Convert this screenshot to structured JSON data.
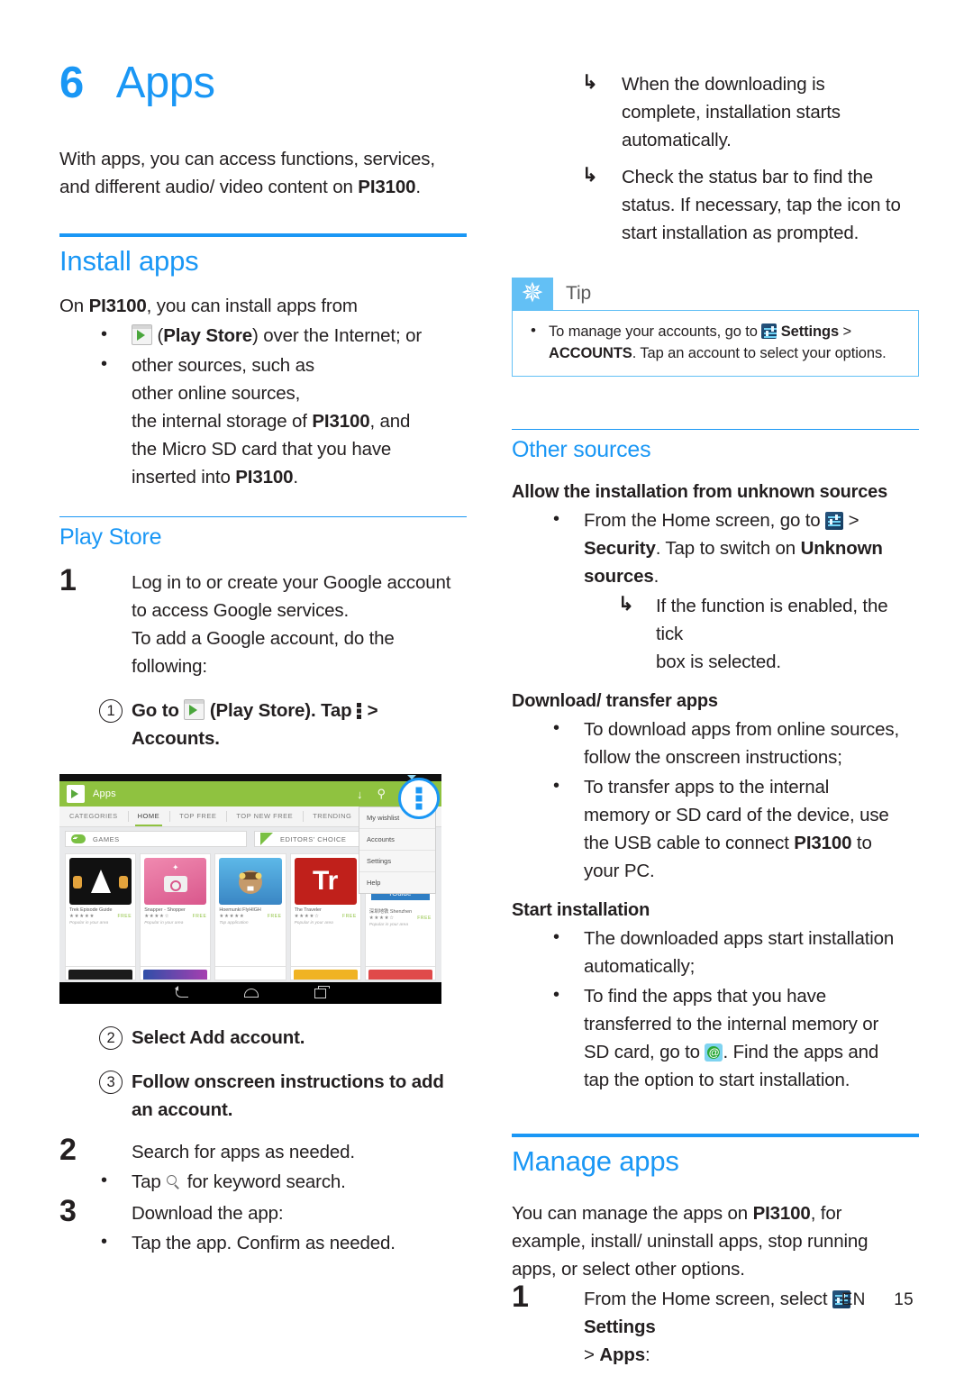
{
  "meta": {
    "accent_blue": "#1a97f5",
    "text_color": "#231f20",
    "tip_blue": "#63c0f5",
    "play_green": "#8fc240"
  },
  "chapter": {
    "number": "6",
    "title": "Apps"
  },
  "intro": {
    "line1_a": "With apps, you can access functions, services,",
    "line1_b": "and different audio/ video content on ",
    "device": "PI3100",
    "line1_c": "."
  },
  "install_apps": {
    "heading": "Install apps",
    "lead_a": "On ",
    "lead_device": "PI3100",
    "lead_b": ", you can install apps from",
    "bullets": [
      {
        "icon": "play-store-icon",
        "bold": "Play Store",
        "pre": "(",
        "post": ") over the Internet; or"
      },
      {
        "lines": [
          "other sources, such as",
          "other online sources,",
          "the internal storage of PI3100, and",
          "the Micro SD card that you have",
          "inserted into PI3100."
        ]
      }
    ]
  },
  "play_store": {
    "heading": "Play Store",
    "step1": {
      "number": "1",
      "line1": "Log in to or create your Google account",
      "line2": "to access Google services.",
      "line3": "To add a Google account, do the following:"
    },
    "substeps": [
      {
        "number": "1",
        "pre": "Go to ",
        "icon": "play-store-icon",
        "mid": " (Play Store). Tap ",
        "icon2": "overflow-menu-icon",
        "post": " >",
        "line2": "Accounts."
      },
      {
        "number": "2",
        "text": "Select Add account."
      },
      {
        "number": "3",
        "text": "Follow onscreen instructions to add",
        "line2": "an account."
      }
    ],
    "step2": {
      "number": "2",
      "text": "Search for apps as needed.",
      "bullet_pre": "Tap ",
      "bullet_icon": "search-icon",
      "bullet_post": " for keyword search."
    },
    "step3": {
      "number": "3",
      "text": "Download the app:",
      "bullet": "Tap the app. Confirm as needed."
    },
    "arrows": [
      {
        "line1": "When the downloading is",
        "line2": "complete, installation starts",
        "line3": "automatically."
      },
      {
        "line1": "Check the status bar to find the",
        "line2": "status. If necessary, tap the icon to",
        "line3": "start installation as prompted."
      }
    ]
  },
  "screenshot": {
    "app_title": "Apps",
    "action_icons": [
      "download-icon",
      "search-icon",
      "overflow-menu-icon"
    ],
    "tabs": [
      "CATEGORIES",
      "HOME",
      "TOP FREE",
      "TOP NEW FREE",
      "TRENDING"
    ],
    "active_tab": "HOME",
    "cards": [
      {
        "label": "GAMES",
        "icon": "gamepad-icon"
      },
      {
        "label": "EDITORS' CHOICE",
        "icon": "editors-choice-icon"
      }
    ],
    "menu_items": [
      "My wishlist",
      "Accounts",
      "Settings",
      "Help"
    ],
    "tiles": [
      {
        "name": "Trek Episode Guide",
        "stars": "★★★★★",
        "price": "FREE",
        "sub": "Popular in your area"
      },
      {
        "name": "Snapper - Shopper",
        "stars": "★★★★☆",
        "price": "FREE",
        "sub": "Popular in your area"
      },
      {
        "name": "Hoemunki FlyHIGH",
        "stars": "★★★★★",
        "price": "FREE",
        "sub": "Top application"
      },
      {
        "name": "The Traveler",
        "stars": "★★★★☆",
        "price": "FREE",
        "sub": "Popular in your area"
      },
      {
        "name": "深圳地铁 Shenzhen",
        "stars": "★★★★☆",
        "price": "FREE",
        "sub": "Popular in your area"
      }
    ],
    "navbar": [
      "back-icon",
      "home-icon",
      "recents-icon"
    ]
  },
  "tip": {
    "label": "Tip",
    "icon": "asterisk-icon",
    "item_a": "To manage your accounts, go to ",
    "item_icon": "settings-icon",
    "item_b_bold": "Settings",
    "item_c": " >",
    "item_d_bold": "ACCOUNTS",
    "item_e": ". Tap an account to select your options."
  },
  "other_sources": {
    "heading": "Other sources",
    "sub1": "Allow the installation from unknown sources",
    "bullet1": {
      "pre": "From the Home screen, go to ",
      "icon": "settings-icon",
      "post": " >",
      "line2_bold": "Security",
      "line2_mid": ". Tap to switch on ",
      "line2_bold2": "Unknown",
      "line3_bold": "sources",
      "line3_post": "."
    },
    "arrow1": {
      "line1": "If the function is enabled, the tick",
      "line2": "box is selected."
    },
    "sub2": "Download/ transfer apps",
    "bullets2": [
      {
        "line1": "To download apps from online sources,",
        "line2": "follow the onscreen instructions;"
      },
      {
        "line1": "To transfer apps to the internal",
        "line2": "memory or SD card of the device, use",
        "line3_a": "the USB cable to connect ",
        "line3_device": "PI3100",
        "line3_b": " to",
        "line4": "your PC."
      }
    ],
    "sub3": "Start installation",
    "bullets3": [
      {
        "line1": "The downloaded apps start installation",
        "line2": "automatically;"
      },
      {
        "line1": "To find the apps that you have",
        "line2": "transferred to the internal memory or",
        "line3_a": "SD card, go to ",
        "line3_icon": "es-file-explorer-icon",
        "line3_b": ". Find the apps and",
        "line4": "tap the option to start installation."
      }
    ]
  },
  "manage_apps": {
    "heading": "Manage apps",
    "lead_a": "You can manage the apps on ",
    "lead_device": "PI3100",
    "lead_b": ", for",
    "lead_line2": "example, install/ uninstall apps, stop running",
    "lead_line3": "apps, or select other options.",
    "step1": {
      "number": "1",
      "pre": "From the Home screen, select ",
      "icon": "settings-icon",
      "bold": "Settings",
      "line2_pre": "> ",
      "line2_bold": "Apps",
      "line2_post": ":"
    }
  },
  "footer": {
    "language": "EN",
    "page": "15"
  }
}
